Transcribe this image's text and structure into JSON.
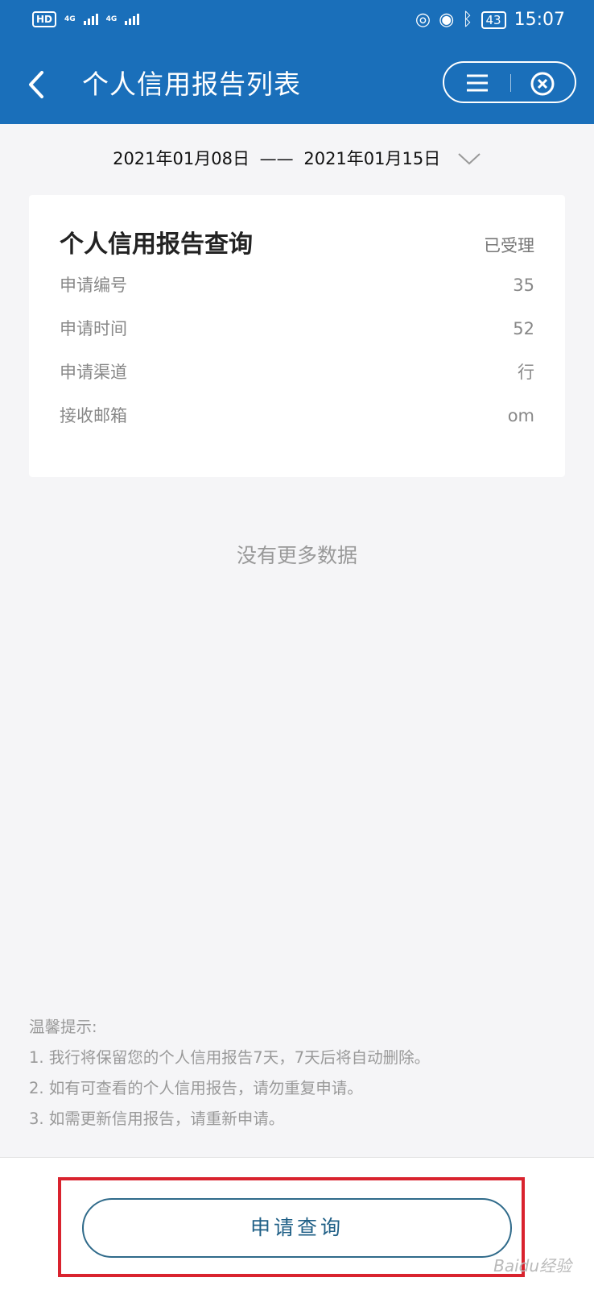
{
  "status_bar": {
    "hd": "HD",
    "sim1": "4G",
    "sim2": "4G",
    "battery": "43",
    "time": "15:07"
  },
  "header": {
    "title": "个人信用报告列表"
  },
  "filter": {
    "start_date": "2021年01月08日",
    "separator": "——",
    "end_date": "2021年01月15日"
  },
  "report_card": {
    "title": "个人信用报告查询",
    "status": "已受理",
    "rows": [
      {
        "label": "申请编号",
        "value": "35"
      },
      {
        "label": "申请时间",
        "value": "52"
      },
      {
        "label": "申请渠道",
        "value": "行"
      },
      {
        "label": "接收邮箱",
        "value": "om"
      }
    ]
  },
  "no_more_text": "没有更多数据",
  "tips": {
    "heading": "温馨提示:",
    "items": [
      "1. 我行将保留您的个人信用报告7天，7天后将自动删除。",
      "2. 如有可查看的个人信用报告，请勿重复申请。",
      "3. 如需更新信用报告，请重新申请。"
    ]
  },
  "footer": {
    "apply_label": "申请查询",
    "watermark": "Baidu经验"
  },
  "colors": {
    "header_bg": "#1a6fba",
    "highlight_border": "#d9232e",
    "button_text": "#1f5f86"
  }
}
